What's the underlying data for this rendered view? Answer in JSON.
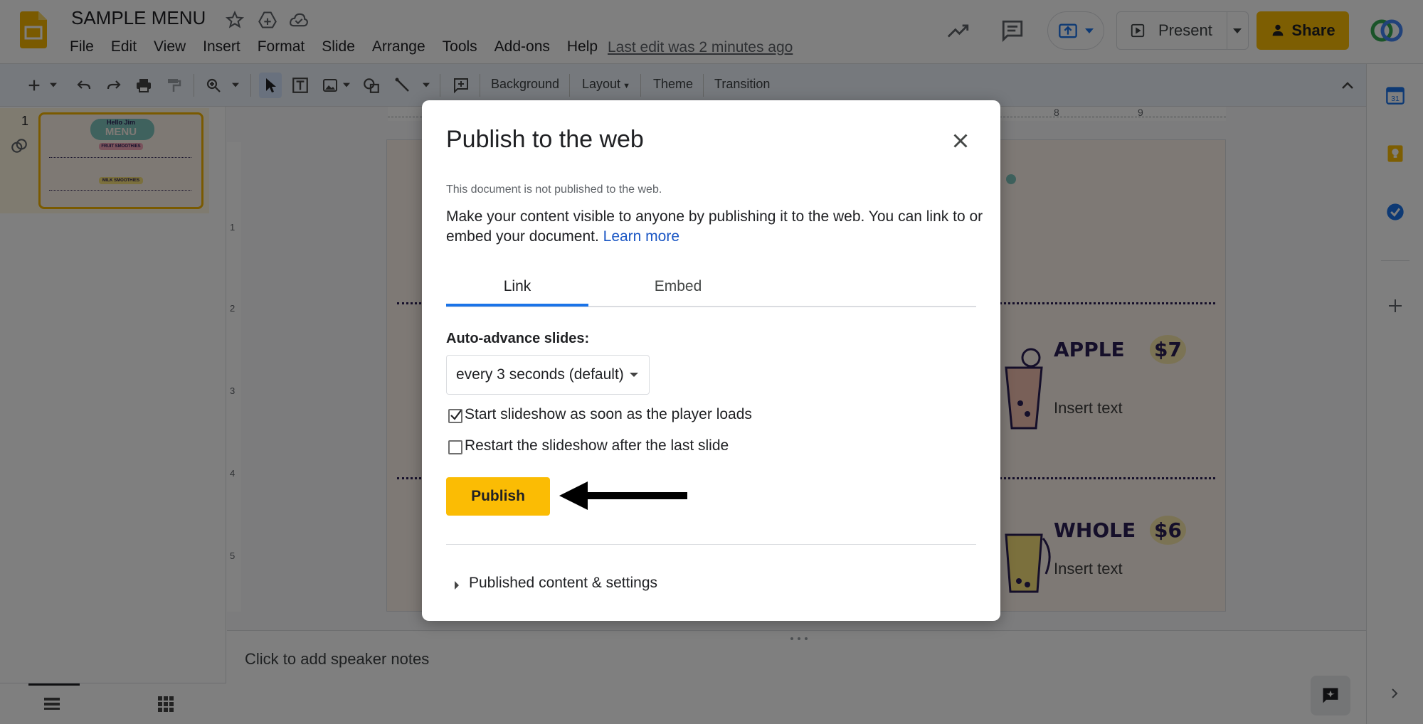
{
  "header": {
    "doc_title": "SAMPLE MENU",
    "menus": [
      "File",
      "Edit",
      "View",
      "Insert",
      "Format",
      "Slide",
      "Arrange",
      "Tools",
      "Add-ons",
      "Help"
    ],
    "last_edit": "Last edit was 2 minutes ago",
    "present_label": "Present",
    "share_label": "Share"
  },
  "toolbar": {
    "background_label": "Background",
    "layout_label": "Layout",
    "theme_label": "Theme",
    "transition_label": "Transition"
  },
  "filmstrip": {
    "slide_number": "1",
    "thumb_title_top": "Hello Jim",
    "thumb_title": "MENU",
    "thumb_section_1": "FRUIT SMOOTHIES",
    "thumb_section_2": "MILK SMOOTHIES"
  },
  "ruler": {
    "top_marks": [
      "8",
      "9"
    ],
    "left_marks": [
      "1",
      "2",
      "3",
      "4",
      "5"
    ]
  },
  "slide": {
    "items": [
      {
        "name": "APPLE",
        "price": "$7",
        "text": "Insert text"
      },
      {
        "name": "WHOLE",
        "price": "$6",
        "text": "Insert text"
      }
    ]
  },
  "notes": {
    "placeholder": "Click to add speaker notes"
  },
  "dialog": {
    "title": "Publish to the web",
    "status": "This document is not published to the web.",
    "description": "Make your content visible to anyone by publishing it to the web. You can link to or embed your document.",
    "learn_more": "Learn more",
    "tabs": [
      {
        "label": "Link",
        "active": true
      },
      {
        "label": "Embed",
        "active": false
      }
    ],
    "auto_advance_label": "Auto-advance slides:",
    "auto_advance_value": "every 3 seconds (default)",
    "checkbox_start": {
      "label": "Start slideshow as soon as the player loads",
      "checked": true
    },
    "checkbox_restart": {
      "label": "Restart the slideshow after the last slide",
      "checked": false
    },
    "publish_label": "Publish",
    "published_settings_label": "Published content & settings"
  },
  "colors": {
    "accent_yellow": "#fbbc04",
    "link_blue": "#1a56c4",
    "tab_blue": "#1a73e8"
  }
}
